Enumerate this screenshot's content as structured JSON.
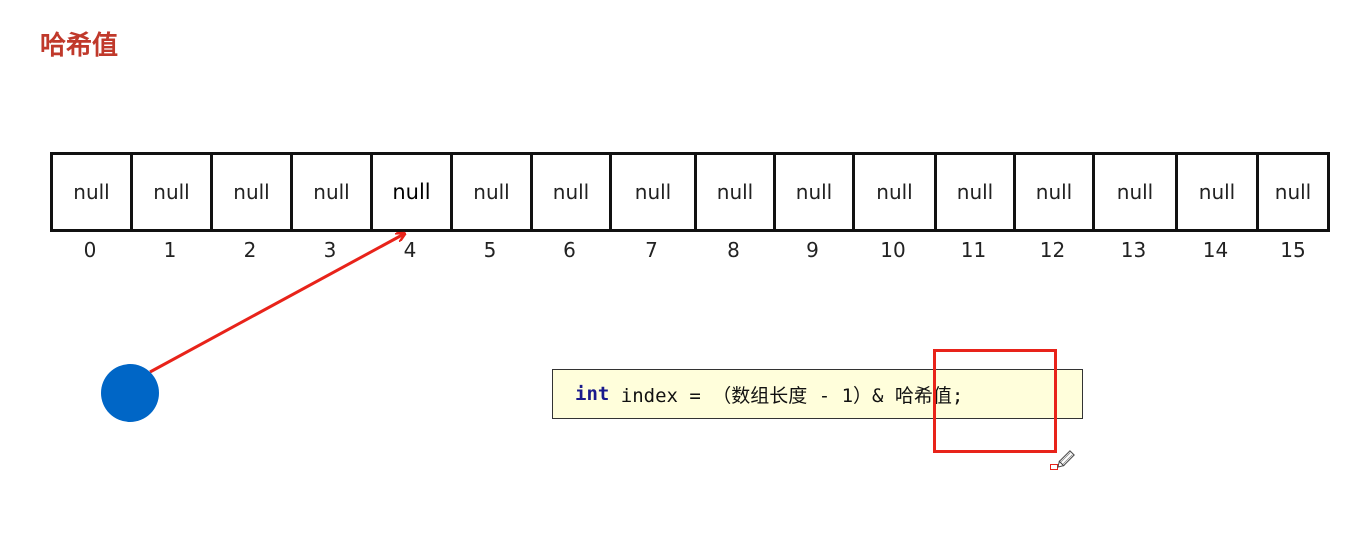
{
  "title": "哈希值",
  "array": {
    "cells": [
      "null",
      "null",
      "null",
      "null",
      "null",
      "null",
      "null",
      "null",
      "null",
      "null",
      "null",
      "null",
      "null",
      "null",
      "null",
      "null"
    ],
    "indices": [
      "0",
      "1",
      "2",
      "3",
      "4",
      "5",
      "6",
      "7",
      "8",
      "9",
      "10",
      "11",
      "12",
      "13",
      "14",
      "15"
    ],
    "highlighted_index": 4
  },
  "code": {
    "keyword": "int",
    "rest": " index = （数组长度 - 1）& 哈希值;"
  },
  "colors": {
    "title": "#c0392b",
    "dot": "#0066c6",
    "arrow": "#e8231a",
    "highlight_box": "#e8231a",
    "code_background": "#fffedb",
    "code_keyword": "#1a1a8c"
  },
  "icons": {
    "pointer": "pencil-icon"
  }
}
